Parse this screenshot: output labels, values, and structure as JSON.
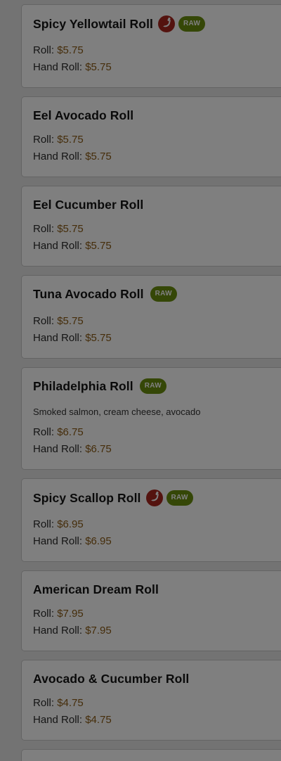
{
  "colors": {
    "price": "#8a5a14",
    "raw_badge": "#6b8e0f",
    "spicy_icon": "#a8271f",
    "overlay": "rgba(0,0,0,0.5)"
  },
  "labels": {
    "roll": "Roll: ",
    "hand_roll": "Hand Roll: ",
    "raw": "RAW"
  },
  "items": [
    {
      "name": "Spicy Yellowtail Roll",
      "spicy": true,
      "raw": true,
      "description": "",
      "roll_price": "$5.75",
      "hand_roll_price": "$5.75"
    },
    {
      "name": "Eel Avocado Roll",
      "spicy": false,
      "raw": false,
      "description": "",
      "roll_price": "$5.75",
      "hand_roll_price": "$5.75"
    },
    {
      "name": "Eel Cucumber Roll",
      "spicy": false,
      "raw": false,
      "description": "",
      "roll_price": "$5.75",
      "hand_roll_price": "$5.75"
    },
    {
      "name": "Tuna Avocado Roll",
      "spicy": false,
      "raw": true,
      "description": "",
      "roll_price": "$5.75",
      "hand_roll_price": "$5.75"
    },
    {
      "name": "Philadelphia Roll",
      "spicy": false,
      "raw": true,
      "description": "Smoked salmon, cream cheese, avocado",
      "roll_price": "$6.75",
      "hand_roll_price": "$6.75"
    },
    {
      "name": "Spicy Scallop Roll",
      "spicy": true,
      "raw": true,
      "description": "",
      "roll_price": "$6.95",
      "hand_roll_price": "$6.95"
    },
    {
      "name": "American Dream Roll",
      "spicy": false,
      "raw": false,
      "description": "",
      "roll_price": "$7.95",
      "hand_roll_price": "$7.95"
    },
    {
      "name": "Avocado & Cucumber Roll",
      "spicy": false,
      "raw": false,
      "description": "",
      "roll_price": "$4.75",
      "hand_roll_price": "$4.75"
    },
    {
      "name": "",
      "spicy": false,
      "raw": false,
      "description": "",
      "roll_price": "",
      "hand_roll_price": ""
    }
  ]
}
